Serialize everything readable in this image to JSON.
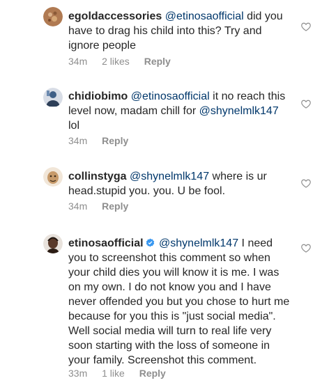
{
  "comments": [
    {
      "username": "egoldaccessories",
      "mention": "@etinosaofficial",
      "text": " did you have to drag his child into this?  Try and ignore people",
      "time": "34m",
      "likes": "2 likes",
      "reply": "Reply",
      "avatar_color": "#b07a52"
    },
    {
      "username": "chidiobimo",
      "mention": "@etinosaofficial",
      "text": " it no reach this level now,  madam chill for ",
      "mention2": "@shynelmlk147",
      "text2": " lol",
      "time": "34m",
      "reply": "Reply",
      "avatar_color": "#3f5f86"
    },
    {
      "username": "collinstyga",
      "mention": "@shynelmlk147",
      "text": " where is ur head.stupid you. you. U be fool.",
      "time": "34m",
      "reply": "Reply",
      "avatar_color": "#c79a6a"
    },
    {
      "username": "etinosaofficial",
      "mention": "@shynelmlk147",
      "text": " I need you to screenshot this comment so when your child dies you will know it is me. I was on my own. I do not know you and I have never offended you but you chose to hurt me because for you this is \"just social media\". Well social media will turn to real life very soon starting with the loss of someone in your family. Screenshot this comment.",
      "time": "33m",
      "likes": "1 like",
      "reply": "Reply",
      "avatar_color": "#5a3a2a",
      "verified": true
    }
  ],
  "icons": {
    "like": "heart-outline-icon",
    "verified": "verified-badge-icon"
  },
  "colors": {
    "text": "#262626",
    "muted": "#8e8e8e",
    "mention": "#00376b",
    "verified": "#3897f0"
  }
}
